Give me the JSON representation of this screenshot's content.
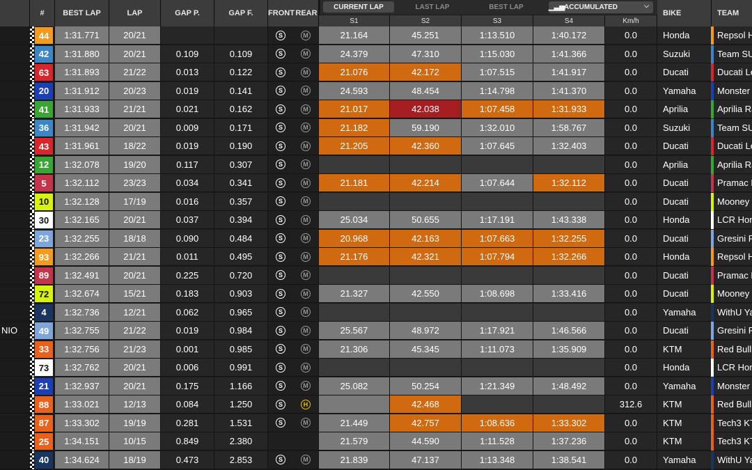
{
  "header": {
    "number": "#",
    "best_lap": "BEST LAP",
    "lap": "LAP",
    "gap_p": "GAP P.",
    "gap_f": "GAP F.",
    "front": "FRONT",
    "rear": "REAR",
    "bike": "BIKE",
    "team": "TEAM"
  },
  "tabs": [
    "CURRENT LAP",
    "LAST LAP",
    "BEST LAP"
  ],
  "active_tab": 0,
  "dropdown": {
    "label": "ACCUMULATED"
  },
  "sectors": [
    "S1",
    "S2",
    "S3",
    "S4",
    "Km/h"
  ],
  "colors": {
    "orange": "#d06a10",
    "red": "#a51e22",
    "grey_dark": "#3a3a3a",
    "grey_light": "#7a7a7a",
    "gaps_bg": "#262626"
  },
  "rows": [
    {
      "left": "",
      "num": "44",
      "numbg": "#f39a1f",
      "numfg": "#ffffff",
      "best": "1:31.771",
      "lap": "20/21",
      "gapp": "",
      "gapf": "",
      "front": "S",
      "rear": "M",
      "s1": "21.164",
      "s1c": "grey",
      "s2": "45.251",
      "s2c": "grey",
      "s3": "1:13.510",
      "s3c": "grey",
      "s4": "1:40.172",
      "s4c": "grey",
      "speed": "0.0",
      "bike": "Honda",
      "team": "Repsol H",
      "tc": "#f39a1f"
    },
    {
      "left": "",
      "num": "42",
      "numbg": "#3d86c6",
      "numfg": "#ffffff",
      "best": "1:31.880",
      "lap": "20/21",
      "gapp": "0.109",
      "gapf": "0.109",
      "front": "S",
      "rear": "M",
      "s1": "24.379",
      "s1c": "grey",
      "s2": "47.310",
      "s2c": "grey",
      "s3": "1:15.030",
      "s3c": "grey",
      "s4": "1:41.366",
      "s4c": "grey",
      "speed": "0.0",
      "bike": "Suzuki",
      "team": "Team SU",
      "tc": "#3d86c6"
    },
    {
      "left": "",
      "num": "63",
      "numbg": "#d8262d",
      "numfg": "#ffffff",
      "best": "1:31.893",
      "lap": "21/22",
      "gapp": "0.013",
      "gapf": "0.122",
      "front": "S",
      "rear": "M",
      "s1": "21.076",
      "s1c": "orange",
      "s2": "42.172",
      "s2c": "orange",
      "s3": "1:07.515",
      "s3c": "grey",
      "s4": "1:41.917",
      "s4c": "grey",
      "speed": "0.0",
      "bike": "Ducati",
      "team": "Ducati Le",
      "tc": "#d8262d"
    },
    {
      "left": "",
      "num": "20",
      "numbg": "#1d3fb5",
      "numfg": "#ffffff",
      "best": "1:31.912",
      "lap": "20/23",
      "gapp": "0.019",
      "gapf": "0.141",
      "front": "S",
      "rear": "M",
      "s1": "24.593",
      "s1c": "grey",
      "s2": "48.454",
      "s2c": "grey",
      "s3": "1:14.798",
      "s3c": "grey",
      "s4": "1:41.370",
      "s4c": "grey",
      "speed": "0.0",
      "bike": "Yamaha",
      "team": "Monster",
      "tc": "#1d3fb5"
    },
    {
      "left": "",
      "num": "41",
      "numbg": "#3aa535",
      "numfg": "#ffffff",
      "best": "1:31.933",
      "lap": "21/21",
      "gapp": "0.021",
      "gapf": "0.162",
      "front": "S",
      "rear": "M",
      "s1": "21.017",
      "s1c": "orange",
      "s2": "42.038",
      "s2c": "red",
      "s3": "1:07.458",
      "s3c": "orange",
      "s4": "1:31.933",
      "s4c": "orange",
      "speed": "0.0",
      "bike": "Aprilia",
      "team": "Aprilia Ra",
      "tc": "#3aa535"
    },
    {
      "left": "",
      "num": "36",
      "numbg": "#3d86c6",
      "numfg": "#ffffff",
      "best": "1:31.942",
      "lap": "20/21",
      "gapp": "0.009",
      "gapf": "0.171",
      "front": "S",
      "rear": "M",
      "s1": "21.182",
      "s1c": "orange",
      "s2": "59.190",
      "s2c": "grey",
      "s3": "1:32.010",
      "s3c": "grey",
      "s4": "1:58.767",
      "s4c": "grey",
      "speed": "0.0",
      "bike": "Suzuki",
      "team": "Team SU",
      "tc": "#3d86c6"
    },
    {
      "left": "",
      "num": "43",
      "numbg": "#d8262d",
      "numfg": "#ffffff",
      "best": "1:31.961",
      "lap": "18/22",
      "gapp": "0.019",
      "gapf": "0.190",
      "front": "S",
      "rear": "M",
      "s1": "21.205",
      "s1c": "orange",
      "s2": "42.360",
      "s2c": "orange",
      "s3": "1:07.645",
      "s3c": "grey",
      "s4": "1:32.403",
      "s4c": "grey",
      "speed": "0.0",
      "bike": "Ducati",
      "team": "Ducati Le",
      "tc": "#d8262d"
    },
    {
      "left": "",
      "num": "12",
      "numbg": "#3aa535",
      "numfg": "#ffffff",
      "best": "1:32.078",
      "lap": "19/20",
      "gapp": "0.117",
      "gapf": "0.307",
      "front": "S",
      "rear": "M",
      "s1": "",
      "s1c": "dark",
      "s2": "",
      "s2c": "dark",
      "s3": "",
      "s3c": "dark",
      "s4": "",
      "s4c": "dark",
      "speed": "0.0",
      "bike": "Aprilia",
      "team": "Aprilia Ra",
      "tc": "#3aa535"
    },
    {
      "left": "",
      "num": "5",
      "numbg": "#c4344a",
      "numfg": "#ffffff",
      "best": "1:32.112",
      "lap": "23/23",
      "gapp": "0.034",
      "gapf": "0.341",
      "front": "S",
      "rear": "M",
      "s1": "21.181",
      "s1c": "orange",
      "s2": "42.214",
      "s2c": "orange",
      "s3": "1:07.644",
      "s3c": "grey",
      "s4": "1:32.112",
      "s4c": "orange",
      "speed": "0.0",
      "bike": "Ducati",
      "team": "Pramac R",
      "tc": "#c4344a"
    },
    {
      "left": "",
      "num": "10",
      "numbg": "#d7f20c",
      "numfg": "#111111",
      "best": "1:32.128",
      "lap": "17/19",
      "gapp": "0.016",
      "gapf": "0.357",
      "front": "S",
      "rear": "M",
      "s1": "",
      "s1c": "dark",
      "s2": "",
      "s2c": "dark",
      "s3": "",
      "s3c": "dark",
      "s4": "",
      "s4c": "dark",
      "speed": "0.0",
      "bike": "Ducati",
      "team": "Mooney",
      "tc": "#d7f20c"
    },
    {
      "left": "",
      "num": "30",
      "numbg": "#ffffff",
      "numfg": "#111111",
      "best": "1:32.165",
      "lap": "20/21",
      "gapp": "0.037",
      "gapf": "0.394",
      "front": "S",
      "rear": "M",
      "s1": "25.034",
      "s1c": "grey",
      "s2": "50.655",
      "s2c": "grey",
      "s3": "1:17.191",
      "s3c": "grey",
      "s4": "1:43.338",
      "s4c": "grey",
      "speed": "0.0",
      "bike": "Honda",
      "team": "LCR Hond",
      "tc": "#ffffff"
    },
    {
      "left": "",
      "num": "23",
      "numbg": "#7fa6da",
      "numfg": "#ffffff",
      "best": "1:32.255",
      "lap": "18/18",
      "gapp": "0.090",
      "gapf": "0.484",
      "front": "S",
      "rear": "M",
      "s1": "20.968",
      "s1c": "orange",
      "s2": "42.163",
      "s2c": "orange",
      "s3": "1:07.663",
      "s3c": "orange",
      "s4": "1:32.255",
      "s4c": "orange",
      "speed": "0.0",
      "bike": "Ducati",
      "team": "Gresini R",
      "tc": "#7fa6da"
    },
    {
      "left": "",
      "num": "93",
      "numbg": "#f39a1f",
      "numfg": "#ffffff",
      "best": "1:32.266",
      "lap": "21/21",
      "gapp": "0.011",
      "gapf": "0.495",
      "front": "S",
      "rear": "M",
      "s1": "21.176",
      "s1c": "orange",
      "s2": "42.321",
      "s2c": "orange",
      "s3": "1:07.794",
      "s3c": "orange",
      "s4": "1:32.266",
      "s4c": "orange",
      "speed": "0.0",
      "bike": "Honda",
      "team": "Repsol H",
      "tc": "#f39a1f"
    },
    {
      "left": "",
      "num": "89",
      "numbg": "#c4344a",
      "numfg": "#ffffff",
      "best": "1:32.491",
      "lap": "20/21",
      "gapp": "0.225",
      "gapf": "0.720",
      "front": "S",
      "rear": "M",
      "s1": "",
      "s1c": "dark",
      "s2": "",
      "s2c": "dark",
      "s3": "",
      "s3c": "dark",
      "s4": "",
      "s4c": "dark",
      "speed": "0.0",
      "bike": "Ducati",
      "team": "Pramac R",
      "tc": "#c4344a"
    },
    {
      "left": "",
      "num": "72",
      "numbg": "#d7f20c",
      "numfg": "#111111",
      "best": "1:32.674",
      "lap": "15/21",
      "gapp": "0.183",
      "gapf": "0.903",
      "front": "S",
      "rear": "M",
      "s1": "21.327",
      "s1c": "grey",
      "s2": "42.550",
      "s2c": "grey",
      "s3": "1:08.698",
      "s3c": "grey",
      "s4": "1:33.416",
      "s4c": "grey",
      "speed": "0.0",
      "bike": "Ducati",
      "team": "Mooney",
      "tc": "#d7f20c"
    },
    {
      "left": "",
      "num": "4",
      "numbg": "#1b3561",
      "numfg": "#ffffff",
      "best": "1:32.736",
      "lap": "12/21",
      "gapp": "0.062",
      "gapf": "0.965",
      "front": "S",
      "rear": "M",
      "s1": "",
      "s1c": "dark",
      "s2": "",
      "s2c": "dark",
      "s3": "",
      "s3c": "dark",
      "s4": "",
      "s4c": "dark",
      "speed": "0.0",
      "bike": "Yamaha",
      "team": "WithU Ya",
      "tc": "#1b3561"
    },
    {
      "left": "NIO",
      "num": "49",
      "numbg": "#7fa6da",
      "numfg": "#ffffff",
      "best": "1:32.755",
      "lap": "21/22",
      "gapp": "0.019",
      "gapf": "0.984",
      "front": "S",
      "rear": "M",
      "s1": "25.567",
      "s1c": "grey",
      "s2": "48.972",
      "s2c": "grey",
      "s3": "1:17.921",
      "s3c": "grey",
      "s4": "1:46.566",
      "s4c": "grey",
      "speed": "0.0",
      "bike": "Ducati",
      "team": "Gresini R",
      "tc": "#7fa6da"
    },
    {
      "left": "",
      "num": "33",
      "numbg": "#e8621d",
      "numfg": "#ffffff",
      "best": "1:32.756",
      "lap": "21/23",
      "gapp": "0.001",
      "gapf": "0.985",
      "front": "S",
      "rear": "M",
      "s1": "21.306",
      "s1c": "grey",
      "s2": "45.345",
      "s2c": "grey",
      "s3": "1:11.073",
      "s3c": "grey",
      "s4": "1:35.909",
      "s4c": "grey",
      "speed": "0.0",
      "bike": "KTM",
      "team": "Red Bull",
      "tc": "#e8621d"
    },
    {
      "left": "",
      "num": "73",
      "numbg": "#ffffff",
      "numfg": "#111111",
      "best": "1:32.762",
      "lap": "20/21",
      "gapp": "0.006",
      "gapf": "0.991",
      "front": "S",
      "rear": "M",
      "s1": "",
      "s1c": "dark",
      "s2": "",
      "s2c": "dark",
      "s3": "",
      "s3c": "dark",
      "s4": "",
      "s4c": "dark",
      "speed": "0.0",
      "bike": "Honda",
      "team": "LCR Hond",
      "tc": "#ffffff"
    },
    {
      "left": "",
      "num": "21",
      "numbg": "#1d3fb5",
      "numfg": "#ffffff",
      "best": "1:32.937",
      "lap": "20/21",
      "gapp": "0.175",
      "gapf": "1.166",
      "front": "S",
      "rear": "M",
      "s1": "25.082",
      "s1c": "grey",
      "s2": "50.254",
      "s2c": "grey",
      "s3": "1:21.349",
      "s3c": "grey",
      "s4": "1:48.492",
      "s4c": "grey",
      "speed": "0.0",
      "bike": "Yamaha",
      "team": "Monster",
      "tc": "#1d3fb5"
    },
    {
      "left": "",
      "num": "88",
      "numbg": "#e8621d",
      "numfg": "#ffffff",
      "best": "1:33.021",
      "lap": "12/13",
      "gapp": "0.084",
      "gapf": "1.250",
      "front": "S",
      "rear": "H",
      "s1": "",
      "s1c": "grey",
      "s2": "42.468",
      "s2c": "orange",
      "s3": "",
      "s3c": "dark",
      "s4": "",
      "s4c": "dark",
      "speed": "312.6",
      "bike": "KTM",
      "team": "Red Bull",
      "tc": "#e8621d"
    },
    {
      "left": "",
      "num": "87",
      "numbg": "#e8621d",
      "numfg": "#ffffff",
      "best": "1:33.302",
      "lap": "19/19",
      "gapp": "0.281",
      "gapf": "1.531",
      "front": "S",
      "rear": "M",
      "s1": "21.449",
      "s1c": "grey",
      "s2": "42.757",
      "s2c": "orange",
      "s3": "1:08.636",
      "s3c": "orange",
      "s4": "1:33.302",
      "s4c": "orange",
      "speed": "0.0",
      "bike": "KTM",
      "team": "Tech3 KT",
      "tc": "#e8621d"
    },
    {
      "left": "",
      "num": "25",
      "numbg": "#e8621d",
      "numfg": "#ffffff",
      "best": "1:34.151",
      "lap": "10/15",
      "gapp": "0.849",
      "gapf": "2.380",
      "front": "",
      "rear": "",
      "s1": "21.579",
      "s1c": "grey",
      "s2": "44.590",
      "s2c": "grey",
      "s3": "1:11.528",
      "s3c": "grey",
      "s4": "1:37.236",
      "s4c": "grey",
      "speed": "0.0",
      "bike": "KTM",
      "team": "Tech3 KT",
      "tc": "#e8621d"
    },
    {
      "left": "",
      "num": "40",
      "numbg": "#1b3561",
      "numfg": "#ffffff",
      "best": "1:34.624",
      "lap": "18/19",
      "gapp": "0.473",
      "gapf": "2.853",
      "front": "S",
      "rear": "M",
      "s1": "21.839",
      "s1c": "grey",
      "s2": "47.137",
      "s2c": "grey",
      "s3": "1:13.348",
      "s3c": "grey",
      "s4": "1:38.541",
      "s4c": "grey",
      "speed": "0.0",
      "bike": "Yamaha",
      "team": "WithU Ya",
      "tc": "#1b3561"
    }
  ]
}
